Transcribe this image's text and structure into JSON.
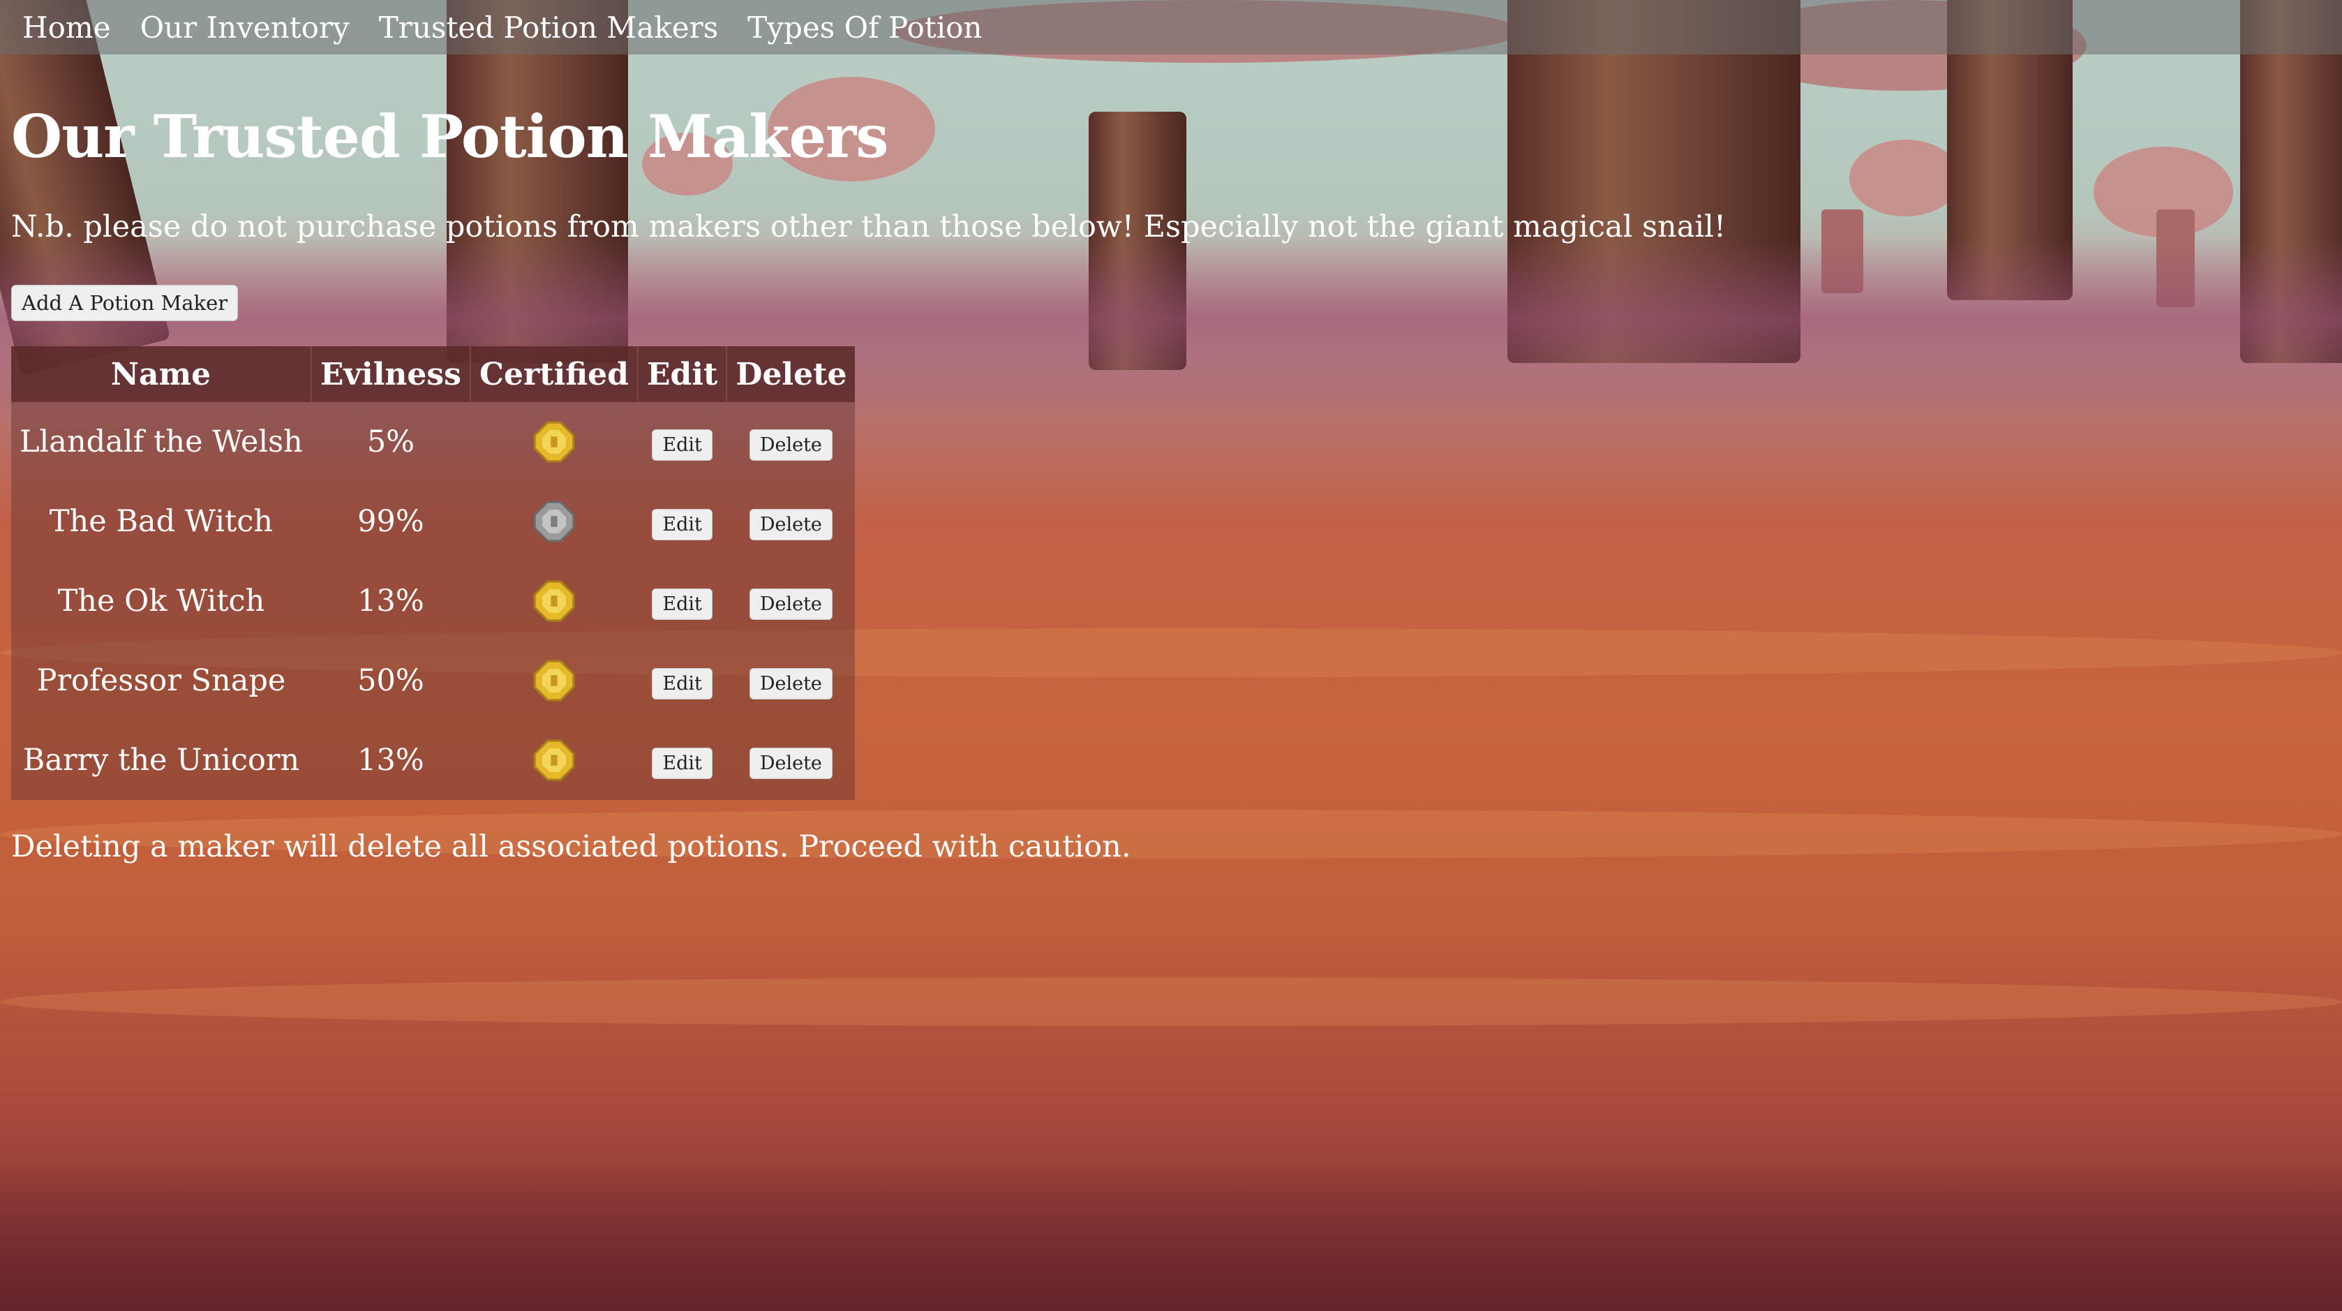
{
  "nav": {
    "links": [
      "Home",
      "Our Inventory",
      "Trusted Potion Makers",
      "Types Of Potion"
    ]
  },
  "page": {
    "title": "Our Trusted Potion Makers",
    "intro": "N.b. please do not purchase potions from makers other than those below! Especially not the giant magical snail!",
    "add_button": "Add A Potion Maker",
    "caution": "Deleting a maker will delete all associated potions. Proceed with caution."
  },
  "table": {
    "headers": [
      "Name",
      "Evilness",
      "Certified",
      "Edit",
      "Delete"
    ],
    "edit_label": "Edit",
    "delete_label": "Delete",
    "rows": [
      {
        "name": "Llandalf the Welsh",
        "evilness": "5%",
        "certified": "gold-coin-icon"
      },
      {
        "name": "The Bad Witch",
        "evilness": "99%",
        "certified": "silver-coin-icon"
      },
      {
        "name": "The Ok Witch",
        "evilness": "13%",
        "certified": "gold-coin-icon"
      },
      {
        "name": "Professor Snape",
        "evilness": "50%",
        "certified": "gold-coin-icon"
      },
      {
        "name": "Barry the Unicorn",
        "evilness": "13%",
        "certified": "gold-coin-icon"
      }
    ]
  },
  "colors": {
    "gold_coin": "#e6b92a",
    "silver_coin": "#9b9b9b",
    "nav_bg": "#6e6e6e",
    "table_bg": "#643232"
  }
}
